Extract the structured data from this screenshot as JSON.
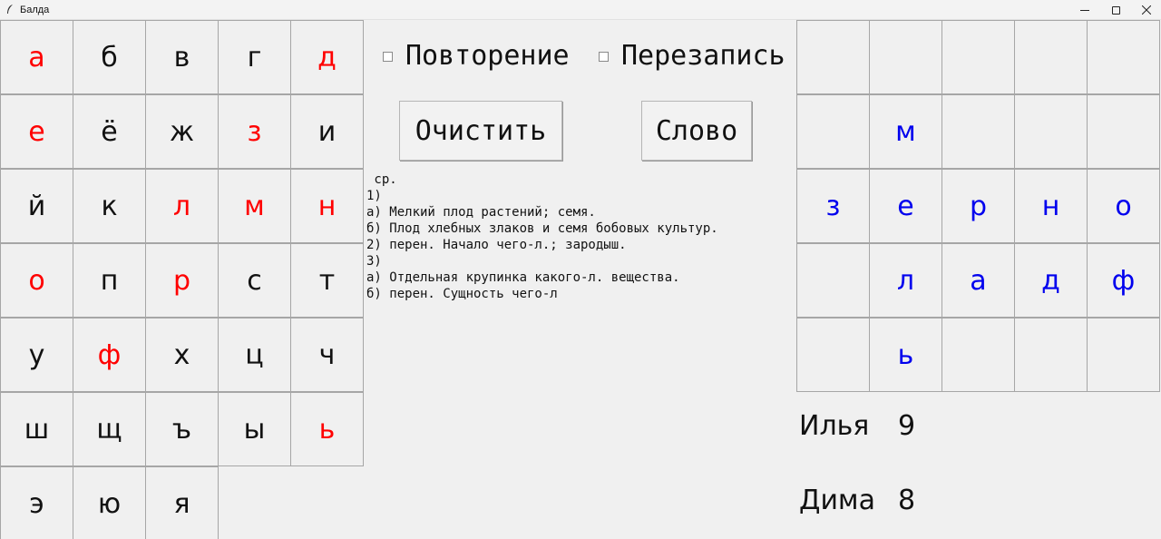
{
  "window": {
    "title": "Балда",
    "icon": "feather-icon"
  },
  "alphabet": [
    {
      "letter": "а",
      "color": "red"
    },
    {
      "letter": "б",
      "color": "black"
    },
    {
      "letter": "в",
      "color": "black"
    },
    {
      "letter": "г",
      "color": "black"
    },
    {
      "letter": "д",
      "color": "red"
    },
    {
      "letter": "е",
      "color": "red"
    },
    {
      "letter": "ё",
      "color": "black"
    },
    {
      "letter": "ж",
      "color": "black"
    },
    {
      "letter": "з",
      "color": "red"
    },
    {
      "letter": "и",
      "color": "black"
    },
    {
      "letter": "й",
      "color": "black"
    },
    {
      "letter": "к",
      "color": "black"
    },
    {
      "letter": "л",
      "color": "red"
    },
    {
      "letter": "м",
      "color": "red"
    },
    {
      "letter": "н",
      "color": "red"
    },
    {
      "letter": "о",
      "color": "red"
    },
    {
      "letter": "п",
      "color": "black"
    },
    {
      "letter": "р",
      "color": "red"
    },
    {
      "letter": "с",
      "color": "black"
    },
    {
      "letter": "т",
      "color": "black"
    },
    {
      "letter": "у",
      "color": "black"
    },
    {
      "letter": "ф",
      "color": "red"
    },
    {
      "letter": "х",
      "color": "black"
    },
    {
      "letter": "ц",
      "color": "black"
    },
    {
      "letter": "ч",
      "color": "black"
    },
    {
      "letter": "ш",
      "color": "black"
    },
    {
      "letter": "щ",
      "color": "black"
    },
    {
      "letter": "ъ",
      "color": "black"
    },
    {
      "letter": "ы",
      "color": "black"
    },
    {
      "letter": "ь",
      "color": "red"
    },
    {
      "letter": "э",
      "color": "black"
    },
    {
      "letter": "ю",
      "color": "black"
    },
    {
      "letter": "я",
      "color": "black"
    }
  ],
  "colors": {
    "used_letter": "#ff0000",
    "unused_letter": "#111111",
    "board_letter": "#0000ee"
  },
  "controls": {
    "repeat_label": "Повторение",
    "overwrite_label": "Перезапись",
    "clear_label": "Очистить",
    "word_label": "Слово"
  },
  "definition": " ср.\n1)\nа) Мелкий плод растений; семя.\nб) Плод хлебных злаков и семя бобовых культур.\n2) перен. Начало чего-л.; зародыш.\n3)\nа) Отдельная крупинка какого-л. вещества.\nб) перен. Сущность чего-л",
  "board": [
    [
      "",
      "",
      "",
      "",
      ""
    ],
    [
      "",
      "м",
      "",
      "",
      ""
    ],
    [
      "з",
      "е",
      "р",
      "н",
      "о"
    ],
    [
      "",
      "л",
      "а",
      "д",
      "ф"
    ],
    [
      "",
      "ь",
      "",
      "",
      ""
    ]
  ],
  "players": [
    {
      "name": "Илья",
      "score": "9"
    },
    {
      "name": "Дима",
      "score": "8"
    }
  ]
}
